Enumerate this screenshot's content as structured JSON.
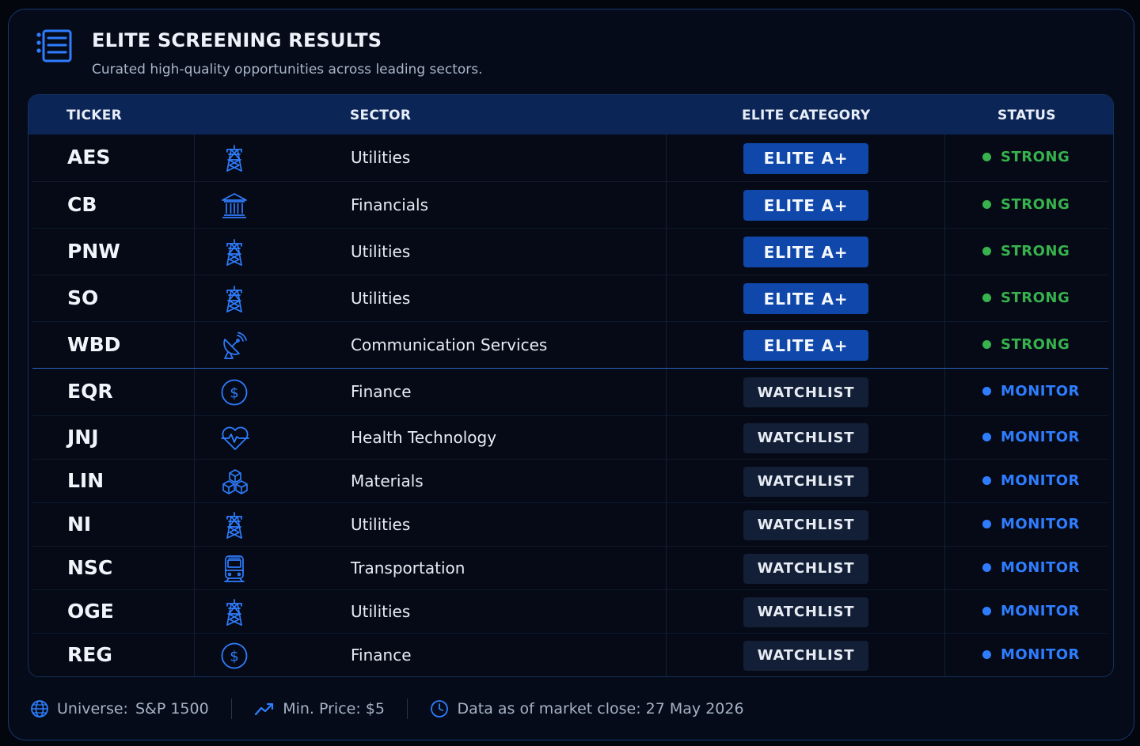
{
  "header": {
    "title": "ELITE SCREENING RESULTS",
    "subtitle": "Curated high-quality opportunities across leading sectors."
  },
  "table": {
    "columns": [
      "TICKER",
      "SECTOR",
      "ELITE CATEGORY",
      "STATUS"
    ],
    "rows": [
      {
        "ticker": "AES",
        "sector_icon": "transmission-tower-icon",
        "sector": "Utilities",
        "category": "ELITE A+",
        "status": "STRONG"
      },
      {
        "ticker": "CB",
        "sector_icon": "bank-building-icon",
        "sector": "Financials",
        "category": "ELITE A+",
        "status": "STRONG"
      },
      {
        "ticker": "PNW",
        "sector_icon": "transmission-tower-icon",
        "sector": "Utilities",
        "category": "ELITE A+",
        "status": "STRONG"
      },
      {
        "ticker": "SO",
        "sector_icon": "transmission-tower-icon",
        "sector": "Utilities",
        "category": "ELITE A+",
        "status": "STRONG"
      },
      {
        "ticker": "WBD",
        "sector_icon": "satellite-dish-icon",
        "sector": "Communication Services",
        "category": "ELITE A+",
        "status": "STRONG"
      },
      {
        "ticker": "EQR",
        "sector_icon": "dollar-coin-icon",
        "sector": "Finance",
        "category": "WATCHLIST",
        "status": "MONITOR"
      },
      {
        "ticker": "JNJ",
        "sector_icon": "heart-pulse-icon",
        "sector": "Health Technology",
        "category": "WATCHLIST",
        "status": "MONITOR"
      },
      {
        "ticker": "LIN",
        "sector_icon": "cubes-icon",
        "sector": "Materials",
        "category": "WATCHLIST",
        "status": "MONITOR"
      },
      {
        "ticker": "NI",
        "sector_icon": "transmission-tower-icon",
        "sector": "Utilities",
        "category": "WATCHLIST",
        "status": "MONITOR"
      },
      {
        "ticker": "NSC",
        "sector_icon": "train-icon",
        "sector": "Transportation",
        "category": "WATCHLIST",
        "status": "MONITOR"
      },
      {
        "ticker": "OGE",
        "sector_icon": "transmission-tower-icon",
        "sector": "Utilities",
        "category": "WATCHLIST",
        "status": "MONITOR"
      },
      {
        "ticker": "REG",
        "sector_icon": "dollar-coin-icon",
        "sector": "Finance",
        "category": "WATCHLIST",
        "status": "MONITOR"
      }
    ]
  },
  "footer": {
    "universe_label": "Universe:",
    "universe_value": "S&P 1500",
    "min_price": "Min. Price: $5",
    "data_as_of": "Data as of market close: 27 May 2026"
  },
  "colors": {
    "accent": "#2f7dff",
    "strong": "#37b24d",
    "monitor": "#2f7dff",
    "elite_pill": "#0f47aa",
    "watch_pill": "#121f36",
    "header_bar": "#0c2557"
  }
}
